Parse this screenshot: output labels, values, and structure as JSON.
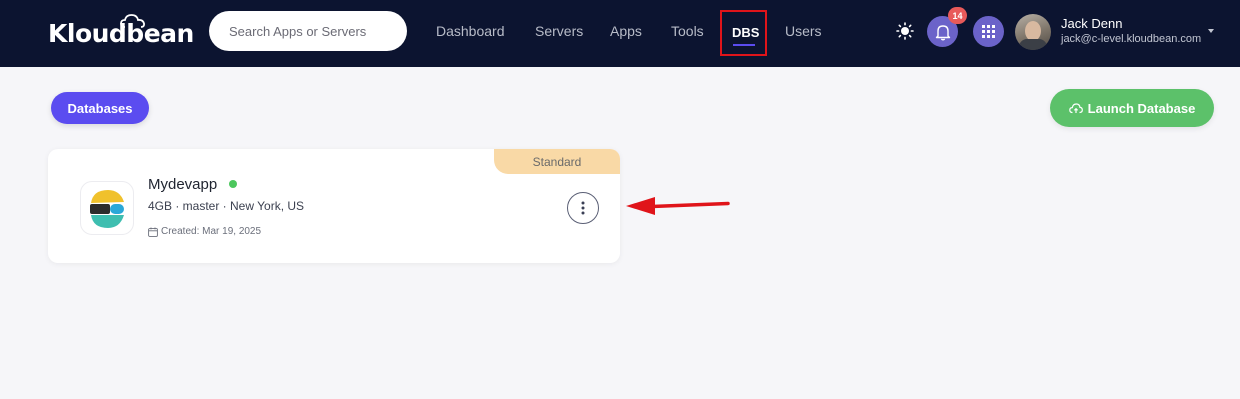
{
  "brand": {
    "logo_text": "Kloudbean"
  },
  "search": {
    "placeholder": "Search Apps or Servers"
  },
  "nav": {
    "items": [
      "Dashboard",
      "Servers",
      "Apps",
      "Tools",
      "DBS",
      "Users"
    ],
    "active": "DBS"
  },
  "notifications": {
    "count": "14"
  },
  "user": {
    "name": "Jack Denn",
    "email": "jack@c-level.kloudbean.com"
  },
  "subheader": {
    "tab_label": "Databases",
    "launch_label": "Launch Database"
  },
  "database": {
    "plan": "Standard",
    "name": "Mydevapp",
    "status": "running",
    "meta": "4GB · master · New York, US",
    "created": "Created: Mar 19, 2025"
  },
  "colors": {
    "navbar": "#0c1430",
    "accent": "#5b4cf0",
    "launch": "#5cc16a",
    "plan_badge": "#f9d9a6",
    "status_online": "#4cc75d",
    "annotation_red": "#e0141a"
  },
  "icons": [
    "cloud-icon",
    "sun-icon",
    "bell-icon",
    "grid-icon",
    "caret-down-icon",
    "cloud-upload-icon",
    "elasticsearch-icon",
    "calendar-icon",
    "more-vertical-icon",
    "arrow-annotation-icon"
  ]
}
